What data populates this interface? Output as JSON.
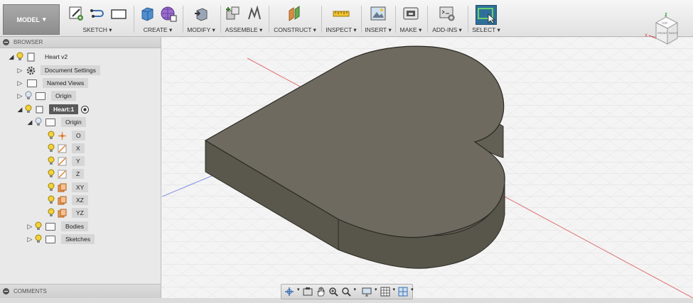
{
  "toolbar": {
    "model_label": "MODEL",
    "groups": [
      {
        "label": "SKETCH"
      },
      {
        "label": "CREATE"
      },
      {
        "label": "MODIFY"
      },
      {
        "label": "ASSEMBLE"
      },
      {
        "label": "CONSTRUCT"
      },
      {
        "label": "INSPECT"
      },
      {
        "label": "INSERT"
      },
      {
        "label": "MAKE"
      },
      {
        "label": "ADD-INS"
      },
      {
        "label": "SELECT"
      }
    ]
  },
  "browser": {
    "title": "BROWSER",
    "root": "Heart v2",
    "document_settings": "Document Settings",
    "named_views": "Named Views",
    "origin": "Origin",
    "component": "Heart:1",
    "component_origin": "Origin",
    "origin_items": [
      "O",
      "X",
      "Y",
      "Z",
      "XY",
      "XZ",
      "YZ"
    ],
    "bodies": "Bodies",
    "sketches": "Sketches"
  },
  "comments": {
    "title": "COMMENTS"
  },
  "viewcube": {
    "top": "TOP",
    "front": "FRONT",
    "right": "RIGHT",
    "axis_x": "X",
    "axis_z": "Z"
  },
  "colors": {
    "model_face_top": "#6e6a5f",
    "model_face_side": "#575449",
    "selection_active": "#2f6f9a",
    "grid": "#dadada",
    "x_axis": "#e07070",
    "y_axis": "#7a8ee0"
  }
}
